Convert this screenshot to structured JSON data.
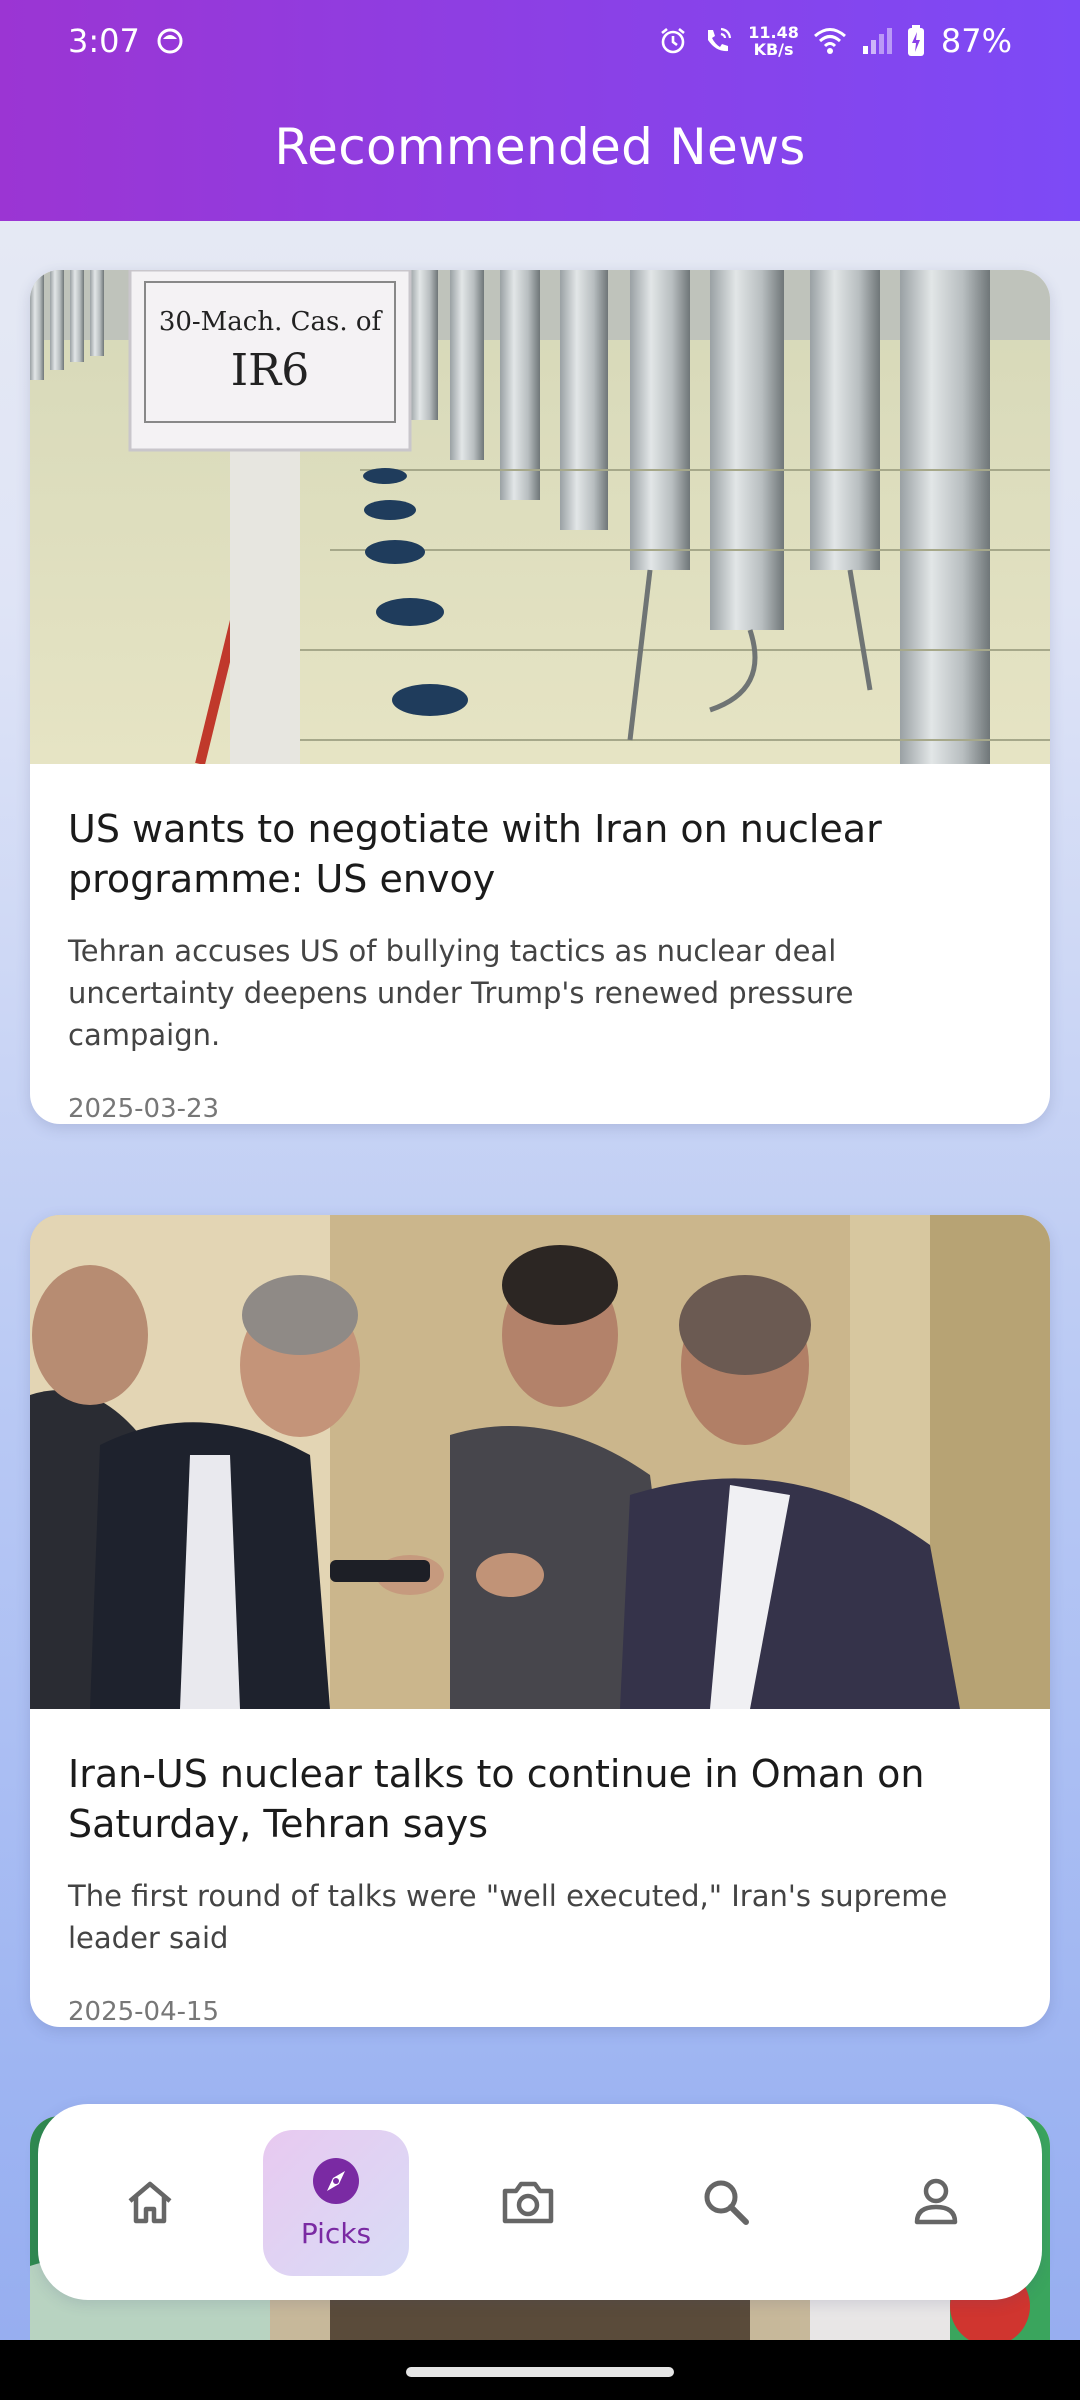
{
  "status_bar": {
    "time": "3:07",
    "net_speed_value": "11.48",
    "net_speed_unit": "KB/s",
    "battery": "87%"
  },
  "header": {
    "title": "Recommended News"
  },
  "articles": [
    {
      "title": "US wants to negotiate with Iran on nuclear programme: US envoy",
      "summary": "Tehran accuses US of bullying tactics as nuclear deal uncertainty deepens under Trump's renewed pressure campaign.",
      "date": "2025-03-23",
      "image_sign_line1": "30-Mach. Cas. of",
      "image_sign_line2": "IR6"
    },
    {
      "title": "Iran-US nuclear talks to continue in Oman on Saturday, Tehran says",
      "summary": "The first round of talks were \"well executed,\" Iran's supreme leader said",
      "date": "2025-04-15"
    }
  ],
  "bottom_nav": {
    "items": [
      {
        "icon": "home-icon",
        "label": ""
      },
      {
        "icon": "compass-icon",
        "label": "Picks",
        "active": true
      },
      {
        "icon": "camera-icon",
        "label": ""
      },
      {
        "icon": "search-icon",
        "label": ""
      },
      {
        "icon": "profile-icon",
        "label": ""
      }
    ]
  },
  "colors": {
    "header_start": "#9b35d3",
    "header_end": "#7d4af6",
    "active_label": "#7a2aa3"
  }
}
